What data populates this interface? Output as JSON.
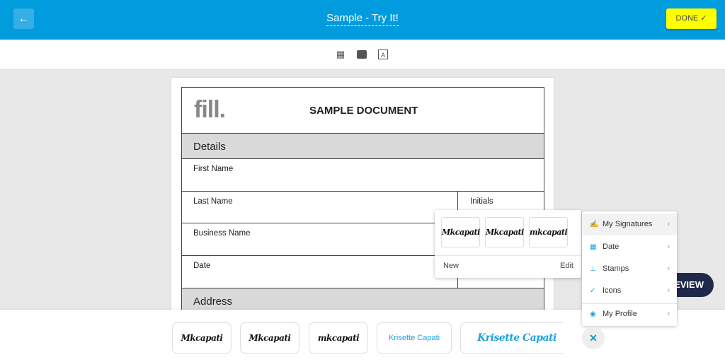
{
  "header": {
    "back_icon": "arrow-left-icon",
    "title": "Sample - Try It!",
    "done_label": "DONE ✓",
    "color": "#019cde",
    "done_color": "#ffff00"
  },
  "toolbar": {
    "icons": [
      "table-icon",
      "image-icon",
      "text-box-icon"
    ]
  },
  "document": {
    "logo": "fill.",
    "title": "SAMPLE DOCUMENT",
    "sections": {
      "details": "Details",
      "address": "Address"
    },
    "fields": {
      "first_name": "First Name",
      "last_name": "Last Name",
      "initials": "Initials",
      "business_name": "Business Name",
      "date": "Date"
    }
  },
  "review_label": "EVIEW",
  "bottom_signatures": [
    "Mkcapati",
    "Mkcapati",
    "mkcapati",
    "Krisette Capati",
    "Krisette Capati"
  ],
  "signature_popup": {
    "signatures": [
      "Mkcapati",
      "Mkcapati",
      "mkcapati"
    ],
    "new_label": "New",
    "edit_label": "Edit"
  },
  "menu": {
    "items": [
      {
        "icon": "signature-icon",
        "label": "My Signatures"
      },
      {
        "icon": "calendar-icon",
        "label": "Date"
      },
      {
        "icon": "stamp-icon",
        "label": "Stamps"
      },
      {
        "icon": "check-circle-icon",
        "label": "Icons"
      },
      {
        "icon": "user-circle-icon",
        "label": "My Profile"
      }
    ]
  },
  "close_label": "✕"
}
